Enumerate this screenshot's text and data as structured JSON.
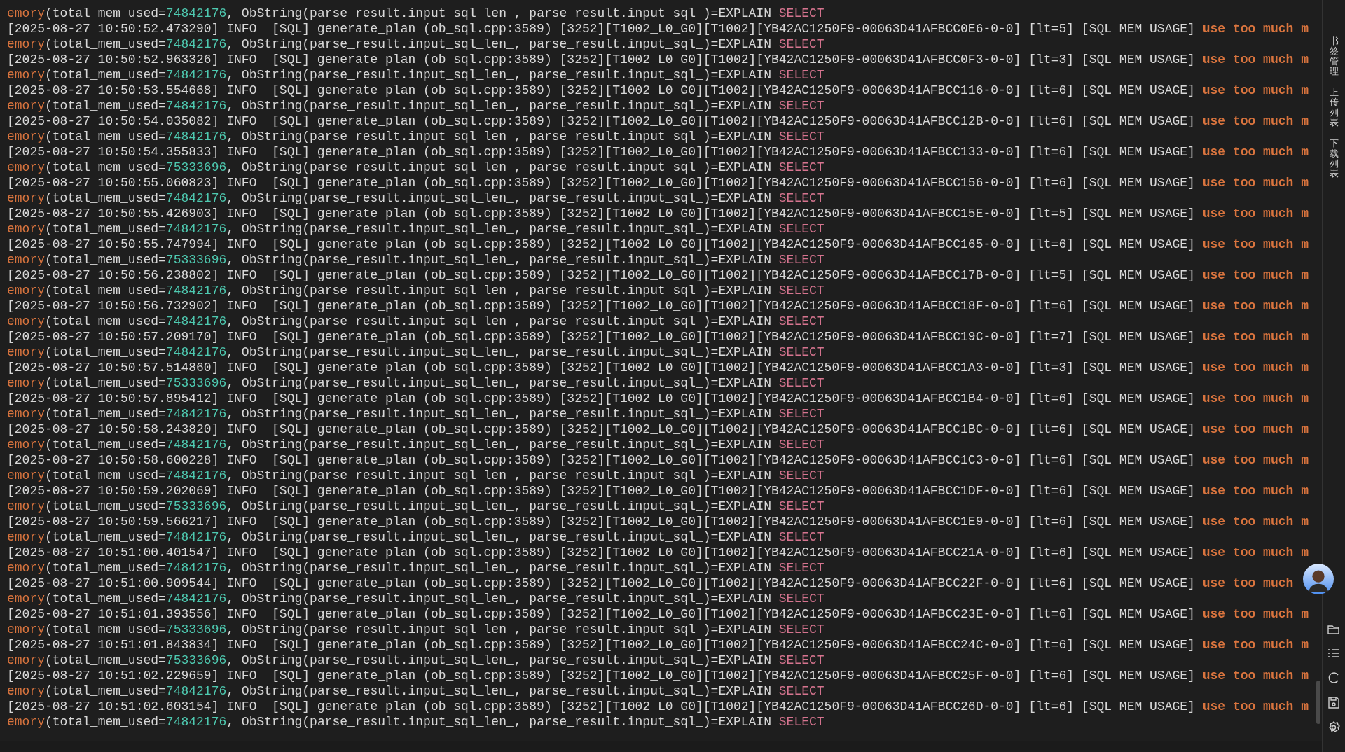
{
  "log_lines": [
    {
      "kind": "mem",
      "head": "emory",
      "body_start": "(total_mem_used=",
      "value": "74842176",
      "body_end": ", ObString(parse_result.input_sql_len_, parse_result.input_sql_)=EXPLAIN",
      "keyword": "SELECT"
    },
    {
      "kind": "info",
      "text": "[2025-08-27 10:50:52.473290] INFO  [SQL] generate_plan (ob_sql.cpp:3589) [3252][T1002_L0_G0][T1002][YB42AC1250F9-00063D41AFBCC0E6-0-0] [lt=5] [SQL MEM USAGE]",
      "warning": "use too much m"
    },
    {
      "kind": "mem",
      "head": "emory",
      "body_start": "(total_mem_used=",
      "value": "74842176",
      "body_end": ", ObString(parse_result.input_sql_len_, parse_result.input_sql_)=EXPLAIN",
      "keyword": "SELECT"
    },
    {
      "kind": "info",
      "text": "[2025-08-27 10:50:52.963326] INFO  [SQL] generate_plan (ob_sql.cpp:3589) [3252][T1002_L0_G0][T1002][YB42AC1250F9-00063D41AFBCC0F3-0-0] [lt=3] [SQL MEM USAGE]",
      "warning": "use too much m"
    },
    {
      "kind": "mem",
      "head": "emory",
      "body_start": "(total_mem_used=",
      "value": "74842176",
      "body_end": ", ObString(parse_result.input_sql_len_, parse_result.input_sql_)=EXPLAIN",
      "keyword": "SELECT"
    },
    {
      "kind": "info",
      "text": "[2025-08-27 10:50:53.554668] INFO  [SQL] generate_plan (ob_sql.cpp:3589) [3252][T1002_L0_G0][T1002][YB42AC1250F9-00063D41AFBCC116-0-0] [lt=6] [SQL MEM USAGE]",
      "warning": "use too much m"
    },
    {
      "kind": "mem",
      "head": "emory",
      "body_start": "(total_mem_used=",
      "value": "74842176",
      "body_end": ", ObString(parse_result.input_sql_len_, parse_result.input_sql_)=EXPLAIN",
      "keyword": "SELECT"
    },
    {
      "kind": "info",
      "text": "[2025-08-27 10:50:54.035082] INFO  [SQL] generate_plan (ob_sql.cpp:3589) [3252][T1002_L0_G0][T1002][YB42AC1250F9-00063D41AFBCC12B-0-0] [lt=6] [SQL MEM USAGE]",
      "warning": "use too much m"
    },
    {
      "kind": "mem",
      "head": "emory",
      "body_start": "(total_mem_used=",
      "value": "74842176",
      "body_end": ", ObString(parse_result.input_sql_len_, parse_result.input_sql_)=EXPLAIN",
      "keyword": "SELECT"
    },
    {
      "kind": "info",
      "text": "[2025-08-27 10:50:54.355833] INFO  [SQL] generate_plan (ob_sql.cpp:3589) [3252][T1002_L0_G0][T1002][YB42AC1250F9-00063D41AFBCC133-0-0] [lt=6] [SQL MEM USAGE]",
      "warning": "use too much m"
    },
    {
      "kind": "mem",
      "head": "emory",
      "body_start": "(total_mem_used=",
      "value": "75333696",
      "body_end": ", ObString(parse_result.input_sql_len_, parse_result.input_sql_)=EXPLAIN",
      "keyword": "SELECT"
    },
    {
      "kind": "info",
      "text": "[2025-08-27 10:50:55.060823] INFO  [SQL] generate_plan (ob_sql.cpp:3589) [3252][T1002_L0_G0][T1002][YB42AC1250F9-00063D41AFBCC156-0-0] [lt=6] [SQL MEM USAGE]",
      "warning": "use too much m"
    },
    {
      "kind": "mem",
      "head": "emory",
      "body_start": "(total_mem_used=",
      "value": "74842176",
      "body_end": ", ObString(parse_result.input_sql_len_, parse_result.input_sql_)=EXPLAIN",
      "keyword": "SELECT"
    },
    {
      "kind": "info",
      "text": "[2025-08-27 10:50:55.426903] INFO  [SQL] generate_plan (ob_sql.cpp:3589) [3252][T1002_L0_G0][T1002][YB42AC1250F9-00063D41AFBCC15E-0-0] [lt=5] [SQL MEM USAGE]",
      "warning": "use too much m"
    },
    {
      "kind": "mem",
      "head": "emory",
      "body_start": "(total_mem_used=",
      "value": "74842176",
      "body_end": ", ObString(parse_result.input_sql_len_, parse_result.input_sql_)=EXPLAIN",
      "keyword": "SELECT"
    },
    {
      "kind": "info",
      "text": "[2025-08-27 10:50:55.747994] INFO  [SQL] generate_plan (ob_sql.cpp:3589) [3252][T1002_L0_G0][T1002][YB42AC1250F9-00063D41AFBCC165-0-0] [lt=6] [SQL MEM USAGE]",
      "warning": "use too much m"
    },
    {
      "kind": "mem",
      "head": "emory",
      "body_start": "(total_mem_used=",
      "value": "75333696",
      "body_end": ", ObString(parse_result.input_sql_len_, parse_result.input_sql_)=EXPLAIN",
      "keyword": "SELECT"
    },
    {
      "kind": "info",
      "text": "[2025-08-27 10:50:56.238802] INFO  [SQL] generate_plan (ob_sql.cpp:3589) [3252][T1002_L0_G0][T1002][YB42AC1250F9-00063D41AFBCC17B-0-0] [lt=5] [SQL MEM USAGE]",
      "warning": "use too much m"
    },
    {
      "kind": "mem",
      "head": "emory",
      "body_start": "(total_mem_used=",
      "value": "74842176",
      "body_end": ", ObString(parse_result.input_sql_len_, parse_result.input_sql_)=EXPLAIN",
      "keyword": "SELECT"
    },
    {
      "kind": "info",
      "text": "[2025-08-27 10:50:56.732902] INFO  [SQL] generate_plan (ob_sql.cpp:3589) [3252][T1002_L0_G0][T1002][YB42AC1250F9-00063D41AFBCC18F-0-0] [lt=6] [SQL MEM USAGE]",
      "warning": "use too much m"
    },
    {
      "kind": "mem",
      "head": "emory",
      "body_start": "(total_mem_used=",
      "value": "74842176",
      "body_end": ", ObString(parse_result.input_sql_len_, parse_result.input_sql_)=EXPLAIN",
      "keyword": "SELECT"
    },
    {
      "kind": "info",
      "text": "[2025-08-27 10:50:57.209170] INFO  [SQL] generate_plan (ob_sql.cpp:3589) [3252][T1002_L0_G0][T1002][YB42AC1250F9-00063D41AFBCC19C-0-0] [lt=7] [SQL MEM USAGE]",
      "warning": "use too much m"
    },
    {
      "kind": "mem",
      "head": "emory",
      "body_start": "(total_mem_used=",
      "value": "74842176",
      "body_end": ", ObString(parse_result.input_sql_len_, parse_result.input_sql_)=EXPLAIN",
      "keyword": "SELECT"
    },
    {
      "kind": "info",
      "text": "[2025-08-27 10:50:57.514860] INFO  [SQL] generate_plan (ob_sql.cpp:3589) [3252][T1002_L0_G0][T1002][YB42AC1250F9-00063D41AFBCC1A3-0-0] [lt=3] [SQL MEM USAGE]",
      "warning": "use too much m"
    },
    {
      "kind": "mem",
      "head": "emory",
      "body_start": "(total_mem_used=",
      "value": "75333696",
      "body_end": ", ObString(parse_result.input_sql_len_, parse_result.input_sql_)=EXPLAIN",
      "keyword": "SELECT"
    },
    {
      "kind": "info",
      "text": "[2025-08-27 10:50:57.895412] INFO  [SQL] generate_plan (ob_sql.cpp:3589) [3252][T1002_L0_G0][T1002][YB42AC1250F9-00063D41AFBCC1B4-0-0] [lt=6] [SQL MEM USAGE]",
      "warning": "use too much m"
    },
    {
      "kind": "mem",
      "head": "emory",
      "body_start": "(total_mem_used=",
      "value": "74842176",
      "body_end": ", ObString(parse_result.input_sql_len_, parse_result.input_sql_)=EXPLAIN",
      "keyword": "SELECT"
    },
    {
      "kind": "info",
      "text": "[2025-08-27 10:50:58.243820] INFO  [SQL] generate_plan (ob_sql.cpp:3589) [3252][T1002_L0_G0][T1002][YB42AC1250F9-00063D41AFBCC1BC-0-0] [lt=6] [SQL MEM USAGE]",
      "warning": "use too much m"
    },
    {
      "kind": "mem",
      "head": "emory",
      "body_start": "(total_mem_used=",
      "value": "74842176",
      "body_end": ", ObString(parse_result.input_sql_len_, parse_result.input_sql_)=EXPLAIN",
      "keyword": "SELECT"
    },
    {
      "kind": "info",
      "text": "[2025-08-27 10:50:58.600228] INFO  [SQL] generate_plan (ob_sql.cpp:3589) [3252][T1002_L0_G0][T1002][YB42AC1250F9-00063D41AFBCC1C3-0-0] [lt=6] [SQL MEM USAGE]",
      "warning": "use too much m"
    },
    {
      "kind": "mem",
      "head": "emory",
      "body_start": "(total_mem_used=",
      "value": "74842176",
      "body_end": ", ObString(parse_result.input_sql_len_, parse_result.input_sql_)=EXPLAIN",
      "keyword": "SELECT"
    },
    {
      "kind": "info",
      "text": "[2025-08-27 10:50:59.202069] INFO  [SQL] generate_plan (ob_sql.cpp:3589) [3252][T1002_L0_G0][T1002][YB42AC1250F9-00063D41AFBCC1DF-0-0] [lt=6] [SQL MEM USAGE]",
      "warning": "use too much m"
    },
    {
      "kind": "mem",
      "head": "emory",
      "body_start": "(total_mem_used=",
      "value": "75333696",
      "body_end": ", ObString(parse_result.input_sql_len_, parse_result.input_sql_)=EXPLAIN",
      "keyword": "SELECT"
    },
    {
      "kind": "info",
      "text": "[2025-08-27 10:50:59.566217] INFO  [SQL] generate_plan (ob_sql.cpp:3589) [3252][T1002_L0_G0][T1002][YB42AC1250F9-00063D41AFBCC1E9-0-0] [lt=6] [SQL MEM USAGE]",
      "warning": "use too much m"
    },
    {
      "kind": "mem",
      "head": "emory",
      "body_start": "(total_mem_used=",
      "value": "74842176",
      "body_end": ", ObString(parse_result.input_sql_len_, parse_result.input_sql_)=EXPLAIN",
      "keyword": "SELECT"
    },
    {
      "kind": "info",
      "text": "[2025-08-27 10:51:00.401547] INFO  [SQL] generate_plan (ob_sql.cpp:3589) [3252][T1002_L0_G0][T1002][YB42AC1250F9-00063D41AFBCC21A-0-0] [lt=6] [SQL MEM USAGE]",
      "warning": "use too much m"
    },
    {
      "kind": "mem",
      "head": "emory",
      "body_start": "(total_mem_used=",
      "value": "74842176",
      "body_end": ", ObString(parse_result.input_sql_len_, parse_result.input_sql_)=EXPLAIN",
      "keyword": "SELECT"
    },
    {
      "kind": "info",
      "text": "[2025-08-27 10:51:00.909544] INFO  [SQL] generate_plan (ob_sql.cpp:3589) [3252][T1002_L0_G0][T1002][YB42AC1250F9-00063D41AFBCC22F-0-0] [lt=6] [SQL MEM USAGE]",
      "warning": "use too much"
    },
    {
      "kind": "mem",
      "head": "emory",
      "body_start": "(total_mem_used=",
      "value": "74842176",
      "body_end": ", ObString(parse_result.input_sql_len_, parse_result.input_sql_)=EXPLAIN",
      "keyword": "SELECT"
    },
    {
      "kind": "info",
      "text": "[2025-08-27 10:51:01.393556] INFO  [SQL] generate_plan (ob_sql.cpp:3589) [3252][T1002_L0_G0][T1002][YB42AC1250F9-00063D41AFBCC23E-0-0] [lt=6] [SQL MEM USAGE]",
      "warning": "use too much m"
    },
    {
      "kind": "mem",
      "head": "emory",
      "body_start": "(total_mem_used=",
      "value": "75333696",
      "body_end": ", ObString(parse_result.input_sql_len_, parse_result.input_sql_)=EXPLAIN",
      "keyword": "SELECT"
    },
    {
      "kind": "info",
      "text": "[2025-08-27 10:51:01.843834] INFO  [SQL] generate_plan (ob_sql.cpp:3589) [3252][T1002_L0_G0][T1002][YB42AC1250F9-00063D41AFBCC24C-0-0] [lt=6] [SQL MEM USAGE]",
      "warning": "use too much m"
    },
    {
      "kind": "mem",
      "head": "emory",
      "body_start": "(total_mem_used=",
      "value": "75333696",
      "body_end": ", ObString(parse_result.input_sql_len_, parse_result.input_sql_)=EXPLAIN",
      "keyword": "SELECT"
    },
    {
      "kind": "info",
      "text": "[2025-08-27 10:51:02.229659] INFO  [SQL] generate_plan (ob_sql.cpp:3589) [3252][T1002_L0_G0][T1002][YB42AC1250F9-00063D41AFBCC25F-0-0] [lt=6] [SQL MEM USAGE]",
      "warning": "use too much m"
    },
    {
      "kind": "mem",
      "head": "emory",
      "body_start": "(total_mem_used=",
      "value": "74842176",
      "body_end": ", ObString(parse_result.input_sql_len_, parse_result.input_sql_)=EXPLAIN",
      "keyword": "SELECT"
    },
    {
      "kind": "info",
      "text": "[2025-08-27 10:51:02.603154] INFO  [SQL] generate_plan (ob_sql.cpp:3589) [3252][T1002_L0_G0][T1002][YB42AC1250F9-00063D41AFBCC26D-0-0] [lt=6] [SQL MEM USAGE]",
      "warning": "use too much m"
    },
    {
      "kind": "mem",
      "head": "emory",
      "body_start": "(total_mem_used=",
      "value": "74842176",
      "body_end": ", ObString(parse_result.input_sql_len_, parse_result.input_sql_)=EXPLAIN",
      "keyword": "SELECT"
    }
  ],
  "side_tabs": [
    "书签管理",
    "上传列表",
    "下载列表"
  ]
}
